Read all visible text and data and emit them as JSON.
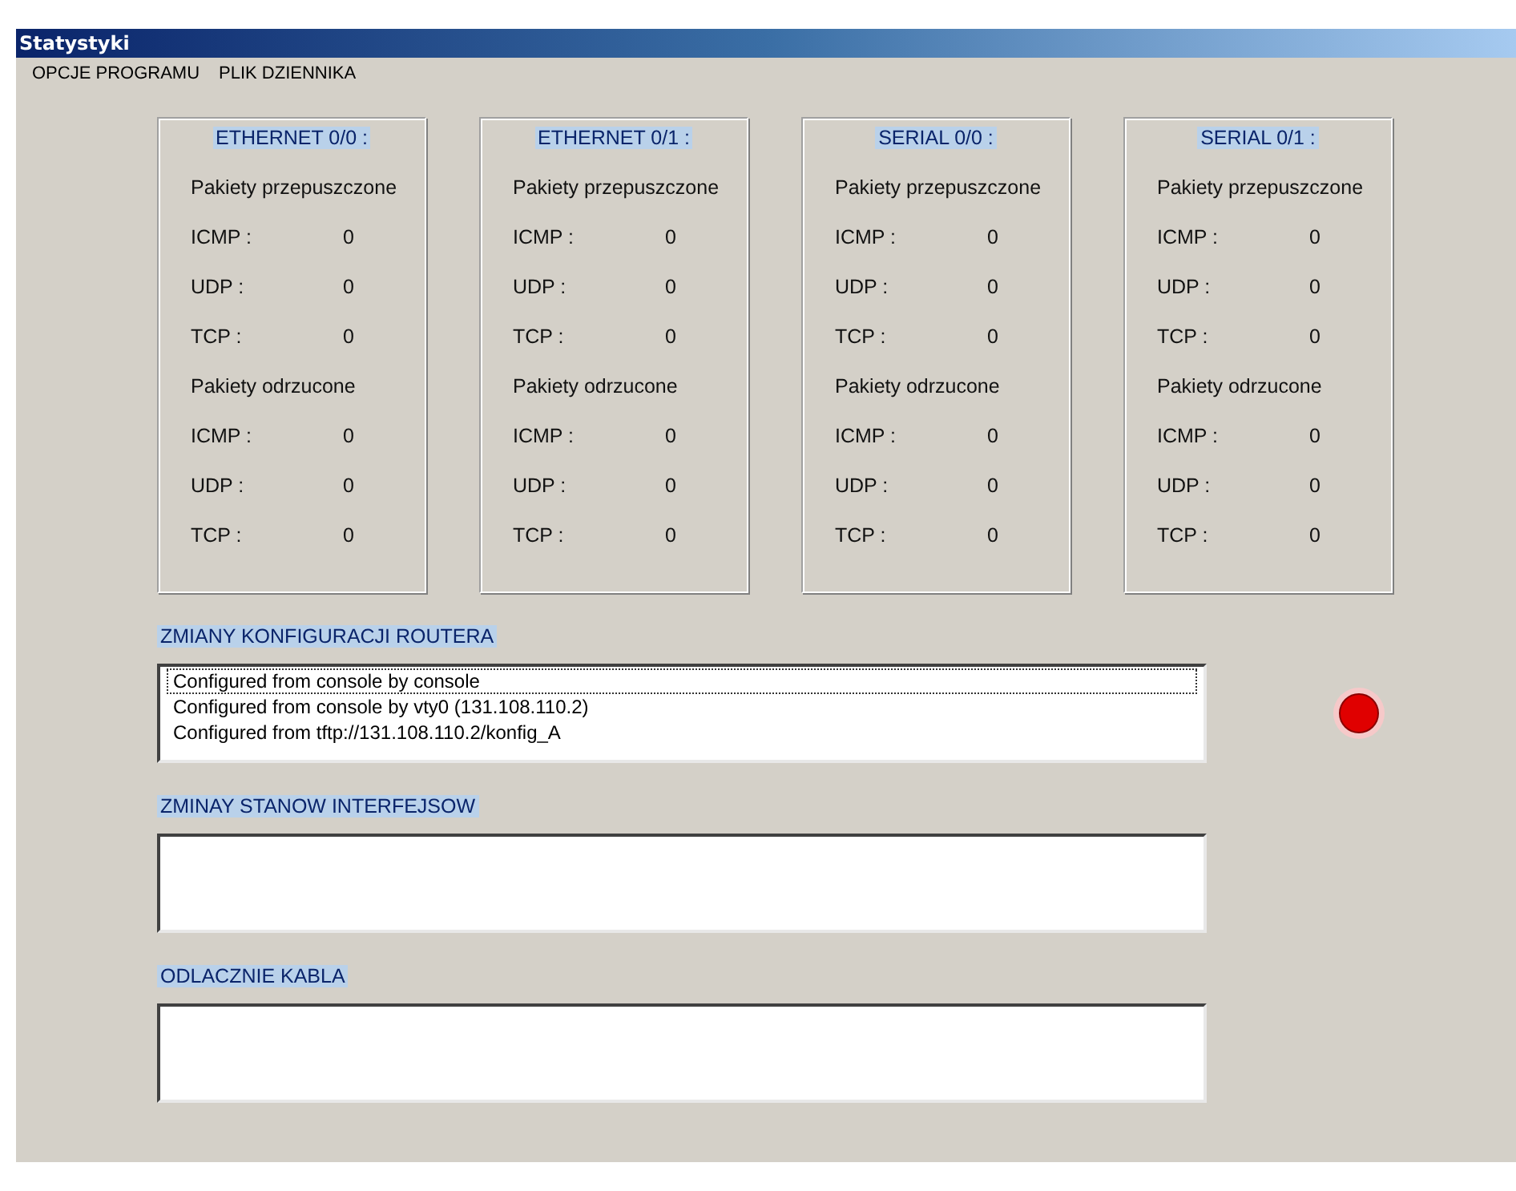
{
  "window": {
    "title": "Statystyki"
  },
  "menu": [
    "OPCJE PROGRAMU",
    "PLIK DZIENNIKA"
  ],
  "interfaces": [
    {
      "title": "ETHERNET 0/0 :",
      "passed_label": "Pakiety przepuszczone",
      "passed": [
        {
          "label": "ICMP :",
          "value": "0"
        },
        {
          "label": "UDP :",
          "value": "0"
        },
        {
          "label": "TCP :",
          "value": "0"
        }
      ],
      "dropped_label": "Pakiety odrzucone",
      "dropped": [
        {
          "label": "ICMP :",
          "value": "0"
        },
        {
          "label": "UDP :",
          "value": "0"
        },
        {
          "label": "TCP :",
          "value": "0"
        }
      ]
    },
    {
      "title": "ETHERNET 0/1 :",
      "passed_label": "Pakiety przepuszczone",
      "passed": [
        {
          "label": "ICMP :",
          "value": "0"
        },
        {
          "label": "UDP :",
          "value": "0"
        },
        {
          "label": "TCP :",
          "value": "0"
        }
      ],
      "dropped_label": "Pakiety odrzucone",
      "dropped": [
        {
          "label": "ICMP :",
          "value": "0"
        },
        {
          "label": "UDP :",
          "value": "0"
        },
        {
          "label": "TCP :",
          "value": "0"
        }
      ]
    },
    {
      "title": "SERIAL 0/0 :",
      "passed_label": "Pakiety przepuszczone",
      "passed": [
        {
          "label": "ICMP :",
          "value": "0"
        },
        {
          "label": "UDP :",
          "value": "0"
        },
        {
          "label": "TCP :",
          "value": "0"
        }
      ],
      "dropped_label": "Pakiety odrzucone",
      "dropped": [
        {
          "label": "ICMP :",
          "value": "0"
        },
        {
          "label": "UDP :",
          "value": "0"
        },
        {
          "label": "TCP :",
          "value": "0"
        }
      ]
    },
    {
      "title": "SERIAL 0/1 :",
      "passed_label": "Pakiety przepuszczone",
      "passed": [
        {
          "label": "ICMP :",
          "value": "0"
        },
        {
          "label": "UDP :",
          "value": "0"
        },
        {
          "label": "TCP :",
          "value": "0"
        }
      ],
      "dropped_label": "Pakiety odrzucone",
      "dropped": [
        {
          "label": "ICMP :",
          "value": "0"
        },
        {
          "label": "UDP :",
          "value": "0"
        },
        {
          "label": "TCP :",
          "value": "0"
        }
      ]
    }
  ],
  "sections": [
    {
      "title": "ZMIANY KONFIGURACJI ROUTERA",
      "lines": [
        {
          "text": "Configured from console by console",
          "selected": true
        },
        {
          "text": "Configured from console by vty0 (131.108.110.2)",
          "selected": false
        },
        {
          "text": "Configured from tftp://131.108.110.2/konfig_A",
          "selected": false
        }
      ],
      "indicator": {
        "color": "#e00000"
      }
    },
    {
      "title": "ZMINAY STANOW INTERFEJSOW"
    },
    {
      "title": "ODLACZNIE KABLA"
    }
  ]
}
